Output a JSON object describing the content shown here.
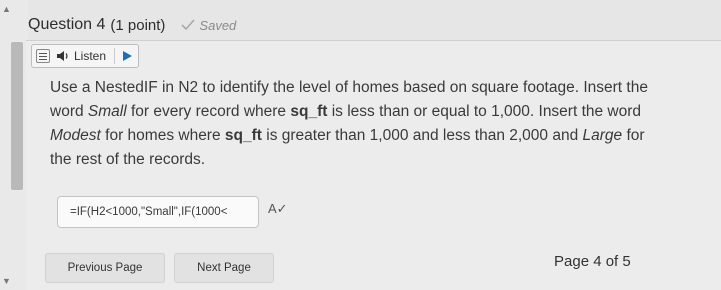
{
  "question": {
    "title": "Question 4",
    "points": "(1 point)",
    "status": "Saved"
  },
  "listen": {
    "label": "Listen"
  },
  "prompt": {
    "p1": "Use a NestedIF in N2 to identify the level of homes based on square footage.  Insert the word ",
    "em1": "Small",
    "p2": " for every record where ",
    "b1": "sq_ft",
    "p3": " is less than or equal to 1,000.  Insert the word ",
    "em2": "Modest",
    "p4": " for homes where ",
    "b2": "sq_ft",
    "p5": " is greater than 1,000 and less than 2,000 and ",
    "em3": "Large",
    "p6": " for the rest of the records."
  },
  "answer": {
    "value": "=IF(H2<1000,\"Small\",IF(1000<"
  },
  "nav": {
    "previous": "Previous Page",
    "next": "Next Page",
    "page_info": "Page 4 of 5"
  },
  "icons": {
    "saved": "checkmark-icon",
    "menu": "menu-icon",
    "speaker": "speaker-icon",
    "play": "play-icon",
    "spellcheck": "spellcheck-icon"
  },
  "colors": {
    "play_accent": "#1f6fb8",
    "background": "#e6e6e6"
  }
}
